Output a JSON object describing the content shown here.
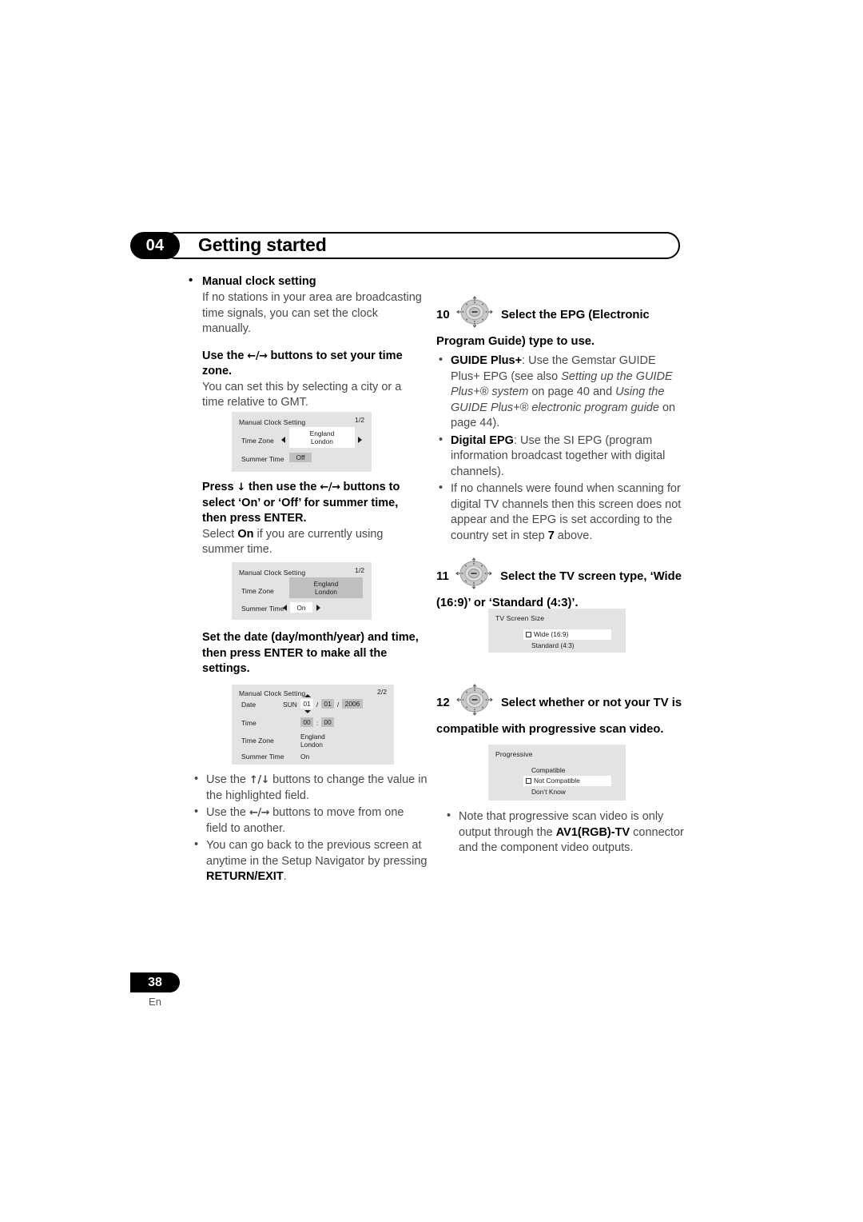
{
  "header": {
    "chapter": "04",
    "title": "Getting started"
  },
  "left_column": {
    "manual_clock": {
      "heading": "Manual clock setting",
      "body": "If no stations in your area are broadcasting time signals, you can set the clock manually."
    },
    "timezone_step": {
      "heading_pre": "Use the ",
      "heading_arrows": "←/→",
      "heading_post": " buttons to set your time zone.",
      "body": "You can set this by selecting a city or a time relative to GMT."
    },
    "dialog1": {
      "title": "Manual Clock Setting",
      "page": "1/2",
      "rows": [
        {
          "label": "Time Zone",
          "value_line1": "England",
          "value_line2": "London"
        },
        {
          "label": "Summer Time",
          "value": "Off"
        }
      ]
    },
    "summer_step": {
      "heading_a": "Press ",
      "heading_arrow_down": "↓",
      "heading_b": " then use the ",
      "heading_arrows": "←/→",
      "heading_c": " buttons to select ‘On’ or ‘Off’ for summer time, then press ENTER.",
      "body_pre": "Select ",
      "body_bold": "On",
      "body_post": " if you are currently using summer time."
    },
    "dialog2": {
      "title": "Manual Clock Setting",
      "page": "1/2",
      "rows": [
        {
          "label": "Time Zone",
          "value_line1": "England",
          "value_line2": "London"
        },
        {
          "label": "Summer Time",
          "value": "On"
        }
      ]
    },
    "date_step": {
      "heading": "Set the date (day/month/year) and time, then press ENTER to make all the settings."
    },
    "dialog3": {
      "title": "Manual Clock Setting",
      "page": "2/2",
      "date_label": "Date",
      "date_day_name": "SUN",
      "date_day": "01",
      "date_month": "01",
      "date_year": "2006",
      "date_sep": "/",
      "time_label": "Time",
      "time_hour": "00",
      "time_sep": ":",
      "time_min": "00",
      "timezone_label": "Time Zone",
      "timezone_line1": "England",
      "timezone_line2": "London",
      "summer_label": "Summer Time",
      "summer_value": "On"
    },
    "notes": [
      {
        "pre": "Use the ",
        "arrows": "↑/↓",
        "post": " buttons to change the value in the highlighted field."
      },
      {
        "pre": "Use the ",
        "arrows": "←/→",
        "post": " buttons to move from one field to another."
      },
      {
        "pre": "You can go back to the previous screen at anytime in the Setup Navigator by pressing ",
        "bold": "RETURN/EXIT",
        "post": "."
      }
    ]
  },
  "right_column": {
    "step10": {
      "number": "10",
      "icon": "dpad-icon",
      "heading": "Select the EPG (Electronic Program Guide) type to use.",
      "bullets": [
        {
          "bold": "GUIDE Plus+",
          "text_a": ": Use the Gemstar GUIDE Plus+ EPG (see also ",
          "italic_a": "Setting up the GUIDE Plus+® system",
          "text_b": " on page 40 and ",
          "italic_b": "Using the GUIDE Plus+® electronic program guide",
          "text_c": " on page 44)."
        },
        {
          "bold": "Digital EPG",
          "text_a": ": Use the SI EPG (program information broadcast together with digital channels)."
        },
        {
          "text_a": "If no channels were found when scanning for digital TV channels then this screen does not appear and the EPG is set according to the country set in step ",
          "bold_mid": "7",
          "text_b": " above."
        }
      ]
    },
    "step11": {
      "number": "11",
      "icon": "dpad-icon",
      "heading": "Select the TV screen type, ‘Wide (16:9)’ or ‘Standard (4:3)’."
    },
    "dialog_tv": {
      "title": "TV Screen Size",
      "options": [
        {
          "label": "Wide (16:9)",
          "selected": true
        },
        {
          "label": "Standard (4:3)",
          "selected": false
        }
      ]
    },
    "step12": {
      "number": "12",
      "icon": "dpad-icon",
      "heading": "Select whether or not your TV is compatible with progressive scan video."
    },
    "dialog_progressive": {
      "title": "Progressive",
      "options": [
        {
          "label": "Compatible",
          "selected": false
        },
        {
          "label": "Not Compatible",
          "selected": true
        },
        {
          "label": "Don‘t Know",
          "selected": false
        }
      ]
    },
    "note": {
      "pre": "Note that progressive scan video is only output through the ",
      "bold": "AV1(RGB)-TV",
      "post": " connector and the component video outputs."
    }
  },
  "footer": {
    "page_number": "38",
    "language": "En"
  }
}
